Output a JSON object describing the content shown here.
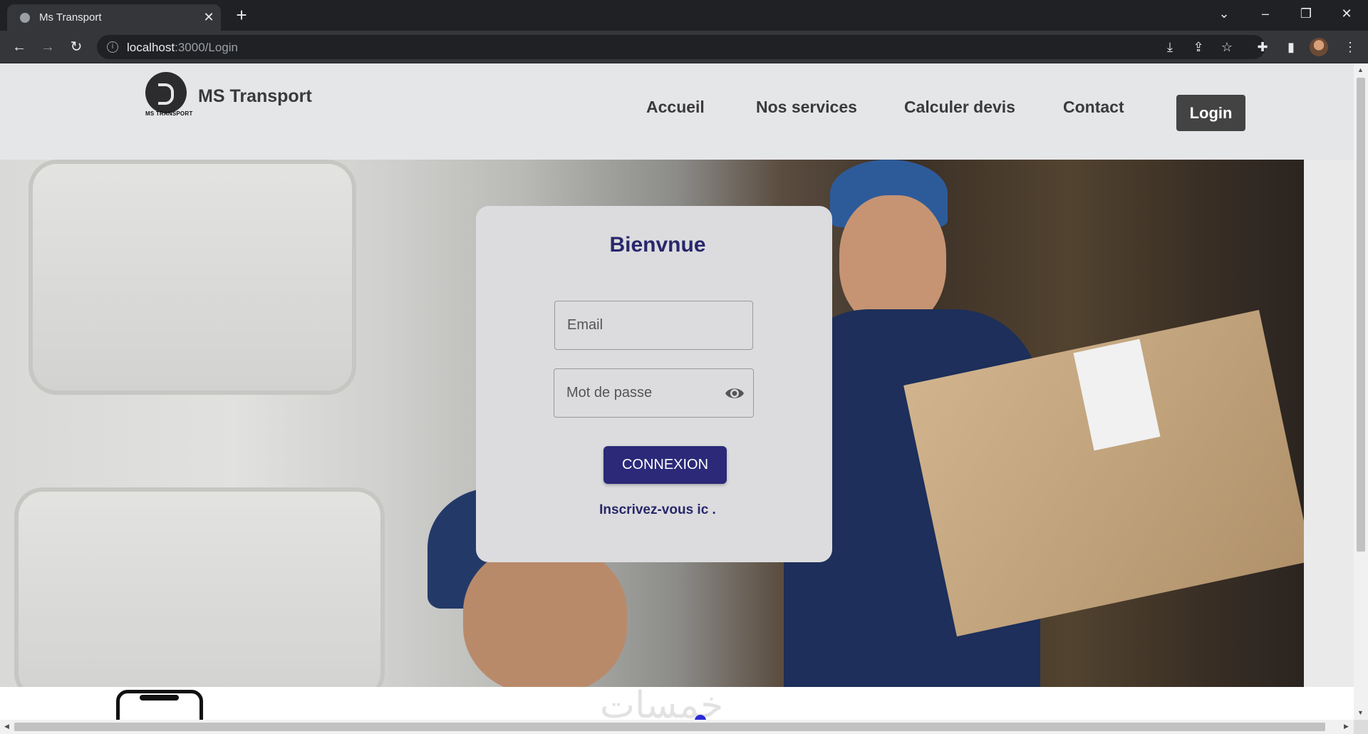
{
  "browser": {
    "tab_title": "Ms Transport",
    "url_host": "localhost",
    "url_path": ":3000/Login"
  },
  "site": {
    "brand": "MS Transport",
    "logo_caption": "MS TRANSPORT",
    "nav": [
      "Accueil",
      "Nos services",
      "Calculer devis",
      "Contact"
    ],
    "login_label": "Login"
  },
  "login_form": {
    "title": "Bienvnue",
    "email_placeholder": "Email",
    "password_placeholder": "Mot de passe",
    "submit_label": "CONNEXION",
    "signup_link": "Inscrivez-vous ic ."
  },
  "footer": {
    "watermark": "خمسات"
  },
  "colors": {
    "accent": "#2b2978",
    "header_bg": "#e5e6e8",
    "login_button": "#434343"
  }
}
